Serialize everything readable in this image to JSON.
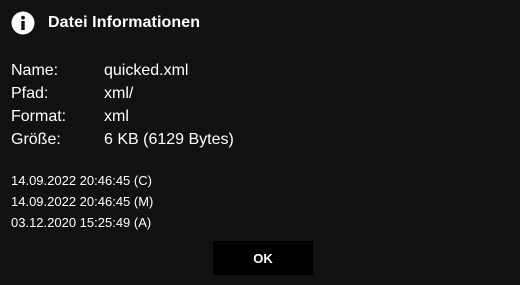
{
  "dialog": {
    "title": "Datei Informationen",
    "icon": "info-icon",
    "properties": [
      {
        "key": "Name:",
        "value": "quicked.xml"
      },
      {
        "key": "Pfad:",
        "value": "xml/"
      },
      {
        "key": "Format:",
        "value": "xml"
      },
      {
        "key": "Größe:",
        "value": "6 KB (6129 Bytes)"
      }
    ],
    "dates": [
      "14.09.2022 20:46:45 (C)",
      "14.09.2022 20:46:45 (M)",
      "03.12.2020 15:25:49 (A)"
    ],
    "ok_label": "OK"
  },
  "colors": {
    "background": "#111111",
    "text": "#ffffff",
    "button_background": "#000000"
  }
}
